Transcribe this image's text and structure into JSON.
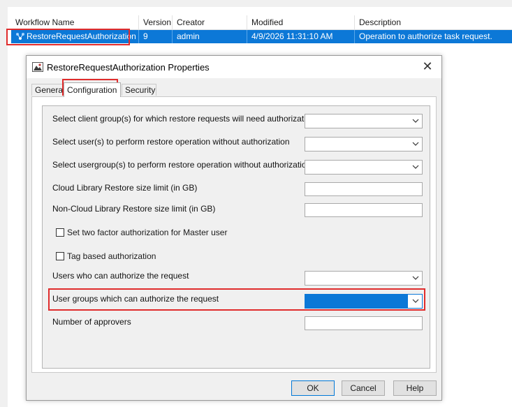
{
  "table": {
    "columns": [
      "Workflow Name",
      "Version",
      "Creator",
      "Modified",
      "Description"
    ],
    "selected_row": {
      "name": "RestoreRequestAuthorization",
      "version": "9",
      "creator": "admin",
      "modified": "4/9/2026 11:31:10 AM",
      "description": "Operation to authorize task request."
    }
  },
  "dialog": {
    "title": "RestoreRequestAuthorization Properties",
    "close_label": "✕",
    "tabs": [
      "General",
      "Configuration",
      "Security"
    ],
    "active_tab": "Configuration",
    "fields": {
      "client_groups_label": "Select client group(s) for which restore requests will need authorization:",
      "users_no_auth_label": "Select user(s) to perform restore operation without authorization",
      "usergroups_no_auth_label": "Select usergroup(s) to perform restore operation without authorization",
      "cloud_limit_label": "Cloud Library Restore size limit (in GB)",
      "noncloud_limit_label": "Non-Cloud Library Restore size limit (in GB)",
      "two_factor_label": "Set two factor authorization for Master user",
      "two_factor_checked": false,
      "tag_based_label": "Tag based authorization",
      "tag_based_checked": false,
      "authorizer_users_label": "Users who can authorize the request",
      "authorizer_groups_label": "User groups which can authorize the request",
      "approvers_label": "Number of approvers"
    },
    "buttons": {
      "ok": "OK",
      "cancel": "Cancel",
      "help": "Help"
    }
  },
  "colors": {
    "selection": "#0c78d7",
    "highlight_box": "#e02c2c"
  }
}
